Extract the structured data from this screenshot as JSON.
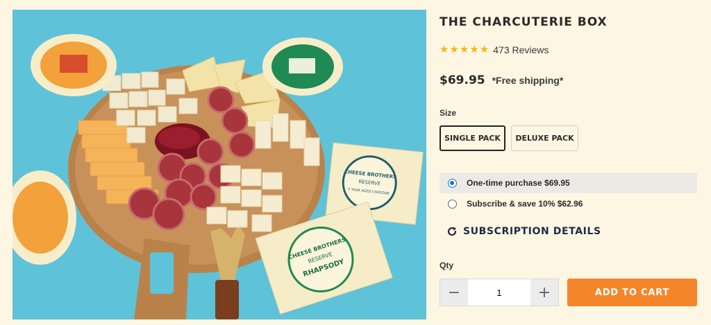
{
  "product": {
    "title": "THE CHARCUTERIE BOX",
    "rating": 5,
    "reviews_label": "473 Reviews",
    "price": "$69.95",
    "shipping_note": "*Free shipping*",
    "image_alt": "Charcuterie board with cheese, salami and jam surrounded by cheese wheels"
  },
  "image_labels": {
    "cheese_brand_top": "CHEESE BROTHERS",
    "reserve": "RESERVE",
    "cheddar": "5 YEAR AGED CHEDDAR",
    "rhapsody": "RHAPSODY"
  },
  "size": {
    "label": "Size",
    "options": [
      "SINGLE PACK",
      "DELUXE PACK"
    ],
    "selected": "SINGLE PACK"
  },
  "purchase_options": [
    {
      "label": "One-time purchase $69.95",
      "selected": true
    },
    {
      "label": "Subscribe & save 10% $62.96",
      "selected": false
    }
  ],
  "subscription_details_label": "SUBSCRIPTION DETAILS",
  "quantity": {
    "label": "Qty",
    "value": "1",
    "minus": "−",
    "plus": "+"
  },
  "add_to_cart_label": "ADD TO CART",
  "colors": {
    "accent": "#f5852a",
    "star": "#f2b90f",
    "radio": "#1a73e8",
    "background": "#fdf6e3"
  }
}
